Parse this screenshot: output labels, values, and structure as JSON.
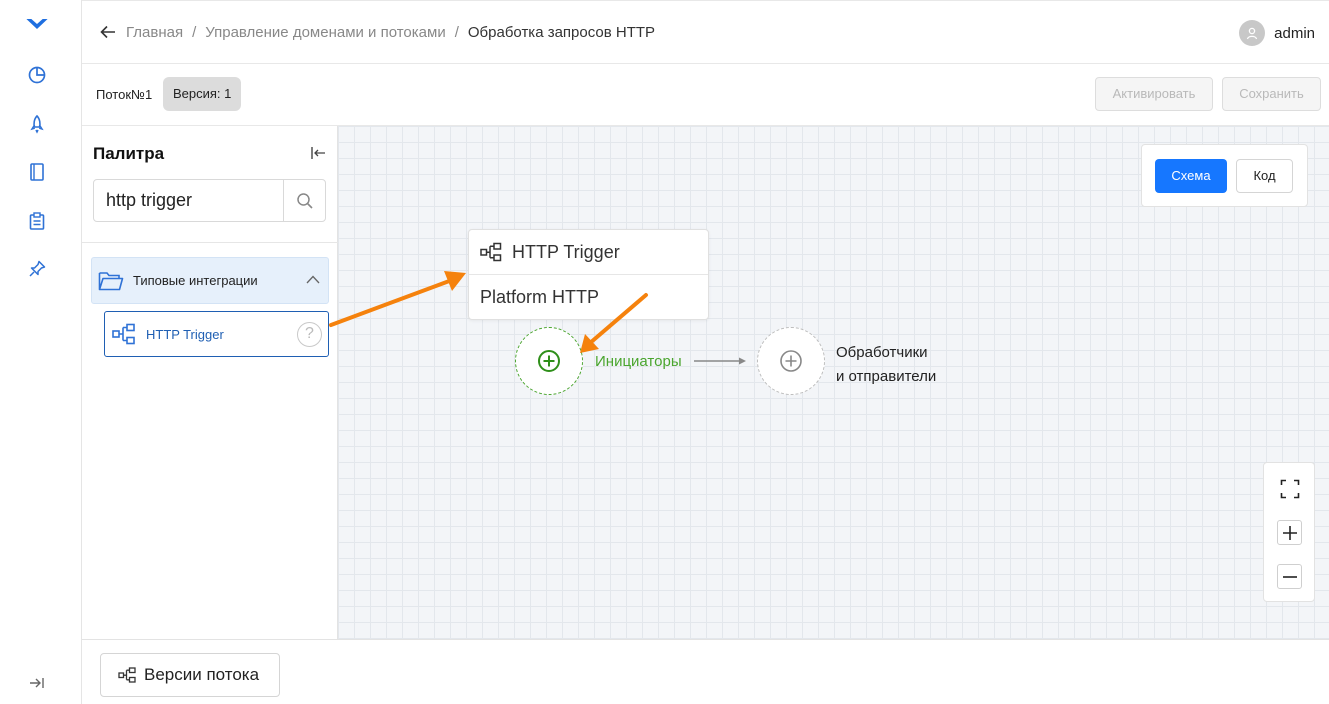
{
  "sidebar": {
    "icons": [
      "logo-icon",
      "dashboard-icon",
      "rocket-icon",
      "book-icon",
      "clipboard-icon",
      "pin-icon"
    ],
    "expand_icon": "expand-sidebar-icon"
  },
  "header": {
    "breadcrumbs": [
      "Главная",
      "Управление доменами и потоками",
      "Обработка запросов HTTP"
    ],
    "separator": "/",
    "user": "admin"
  },
  "toolbar": {
    "flow_name": "Поток№1",
    "version": "Версия: 1",
    "activate_label": "Активировать",
    "save_label": "Сохранить"
  },
  "palette": {
    "title": "Палитра",
    "search_value": "http trigger",
    "group_label": "Типовые интеграции",
    "item_label": "HTTP Trigger",
    "help_glyph": "?"
  },
  "canvas": {
    "view_schema": "Схема",
    "view_code": "Код",
    "node_title": "HTTP Trigger",
    "node_subtitle": "Platform HTTP",
    "initiators_label": "Инициаторы",
    "processors_line1": "Обработчики",
    "processors_line2": "и отправители"
  },
  "footer": {
    "versions_label": "Версии потока"
  },
  "colors": {
    "accent": "#1677ff",
    "link": "#1f5fb3",
    "initiator_green": "#4aa52e",
    "annotation_arrow": "#f5820d"
  }
}
